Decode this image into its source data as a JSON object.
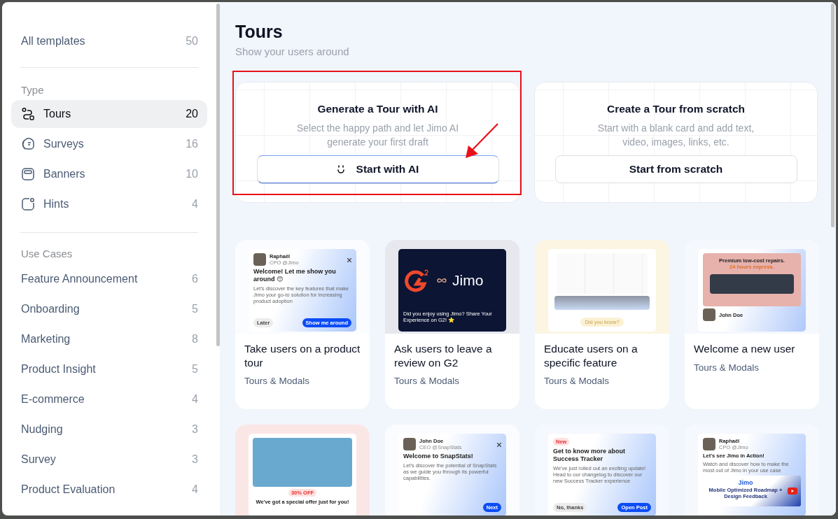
{
  "sidebar": {
    "all": {
      "label": "All templates",
      "count": "50"
    },
    "type_heading": "Type",
    "types": [
      {
        "kind": "tours",
        "label": "Tours",
        "count": "20",
        "selected": true
      },
      {
        "kind": "surveys",
        "label": "Surveys",
        "count": "16",
        "selected": false
      },
      {
        "kind": "banners",
        "label": "Banners",
        "count": "10",
        "selected": false
      },
      {
        "kind": "hints",
        "label": "Hints",
        "count": "4",
        "selected": false
      }
    ],
    "use_cases_heading": "Use Cases",
    "use_cases": [
      {
        "label": "Feature Announcement",
        "count": "6"
      },
      {
        "label": "Onboarding",
        "count": "5"
      },
      {
        "label": "Marketing",
        "count": "8"
      },
      {
        "label": "Product Insight",
        "count": "5"
      },
      {
        "label": "E-commerce",
        "count": "4"
      },
      {
        "label": "Nudging",
        "count": "3"
      },
      {
        "label": "Survey",
        "count": "3"
      },
      {
        "label": "Product Evaluation",
        "count": "4"
      }
    ]
  },
  "header": {
    "title": "Tours",
    "subtitle": "Show your users around"
  },
  "start_cards": [
    {
      "kind": "ai",
      "title": "Generate a Tour with AI",
      "description": "Select the happy path and let Jimo AI generate your first draft",
      "button": "Start with AI",
      "annotated": true
    },
    {
      "kind": "scratch",
      "title": "Create a Tour from scratch",
      "description": "Start with a blank card and add text, video, images, links, etc.",
      "button": "Start from scratch",
      "annotated": false
    }
  ],
  "templates": [
    {
      "kind": "modal",
      "author": "Raphaël",
      "role": "CPO @Jimo",
      "title": "Welcome! Let me show you around 😊",
      "body": "Let's discover the key features that make Jimo your go-to solution for increasing product adoption",
      "secondary": "Later",
      "primary": "Show me around",
      "name": "Take users on a product tour",
      "category": "Tours & Modals"
    },
    {
      "kind": "g2",
      "brand": "Jimo",
      "body": "Did you enjoy using Jimo? Share Your Experience on G2! ⭐",
      "name": "Ask users to leave a review on G2",
      "category": "Tours & Modals"
    },
    {
      "kind": "mockup",
      "bubble": "Did you know?",
      "name": "Educate users on a specific feature",
      "category": "Tours & Modals"
    },
    {
      "kind": "site",
      "headline": "Premium low-cost repairs.",
      "accent": "24 hours express.",
      "author": "John Doe",
      "name": "Welcome a new user",
      "category": "Tours & Modals"
    },
    {
      "kind": "offer",
      "badge": "30% OFF",
      "title": "We've got a special offer just for you!"
    },
    {
      "kind": "modal",
      "author": "John Doe",
      "role": "CEO @SnapStats",
      "title": "Welcome to SnapStats!",
      "body": "Let's discover the potential of SnapStats as we guide you through its powerful capabilities.",
      "primary": "Next"
    },
    {
      "kind": "post",
      "badge": "New",
      "title": "Get to know more about Success Tracker",
      "body": "We've just rolled out an exciting update! Head to our changelog to discover our new Success Tracker experience",
      "secondary": "No, thanks",
      "primary": "Open Post"
    },
    {
      "kind": "video",
      "author": "Raphaël",
      "role": "CPO @Jimo",
      "title": "Let's see Jimo in Action!",
      "body": "Watch and discover how to make the most out of Jimo in your use case",
      "brand": "Jimo",
      "video_title": "Mobile Optimized Roadmap + Design Feedback"
    }
  ]
}
